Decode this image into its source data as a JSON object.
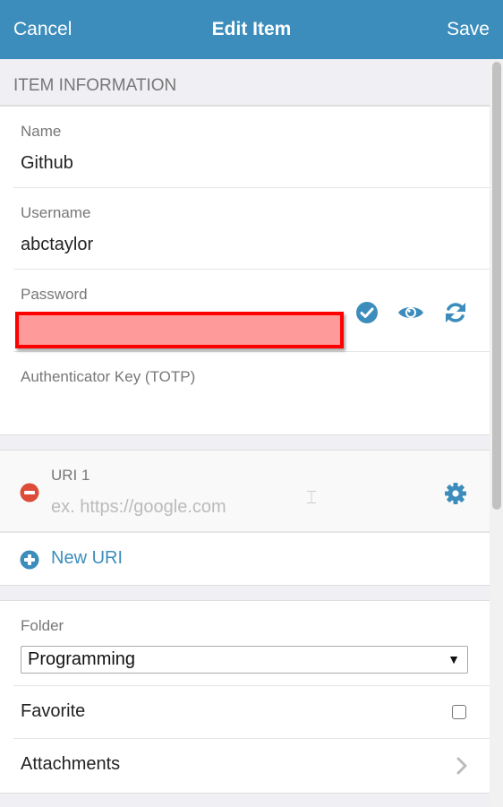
{
  "header": {
    "cancel_label": "Cancel",
    "title": "Edit Item",
    "save_label": "Save"
  },
  "item_information": {
    "section_title": "ITEM INFORMATION",
    "name_label": "Name",
    "name_value": "Github",
    "username_label": "Username",
    "username_value": "abctaylor",
    "password_label": "Password",
    "password_value_redacted": true,
    "totp_label": "Authenticator Key (TOTP)",
    "totp_value": ""
  },
  "uris": {
    "items": [
      {
        "label": "URI 1",
        "value": "",
        "placeholder": "ex. https://google.com"
      }
    ],
    "new_uri_label": "New URI"
  },
  "other": {
    "folder_label": "Folder",
    "folder_selected": "Programming",
    "favorite_label": "Favorite",
    "favorite_checked": false,
    "attachments_label": "Attachments"
  },
  "icons": {
    "check_password": "check-circle-icon",
    "toggle_visibility": "eye-icon",
    "generate_password": "refresh-icon",
    "remove_uri": "minus-circle-icon",
    "uri_options": "gear-icon",
    "add_uri": "plus-circle-icon",
    "attachments_arrow": "chevron-right-icon"
  },
  "colors": {
    "header_bg": "#3c8dbc",
    "accent": "#3c8dbc",
    "remove": "#dd4b39",
    "page_bg": "#efeff4"
  }
}
